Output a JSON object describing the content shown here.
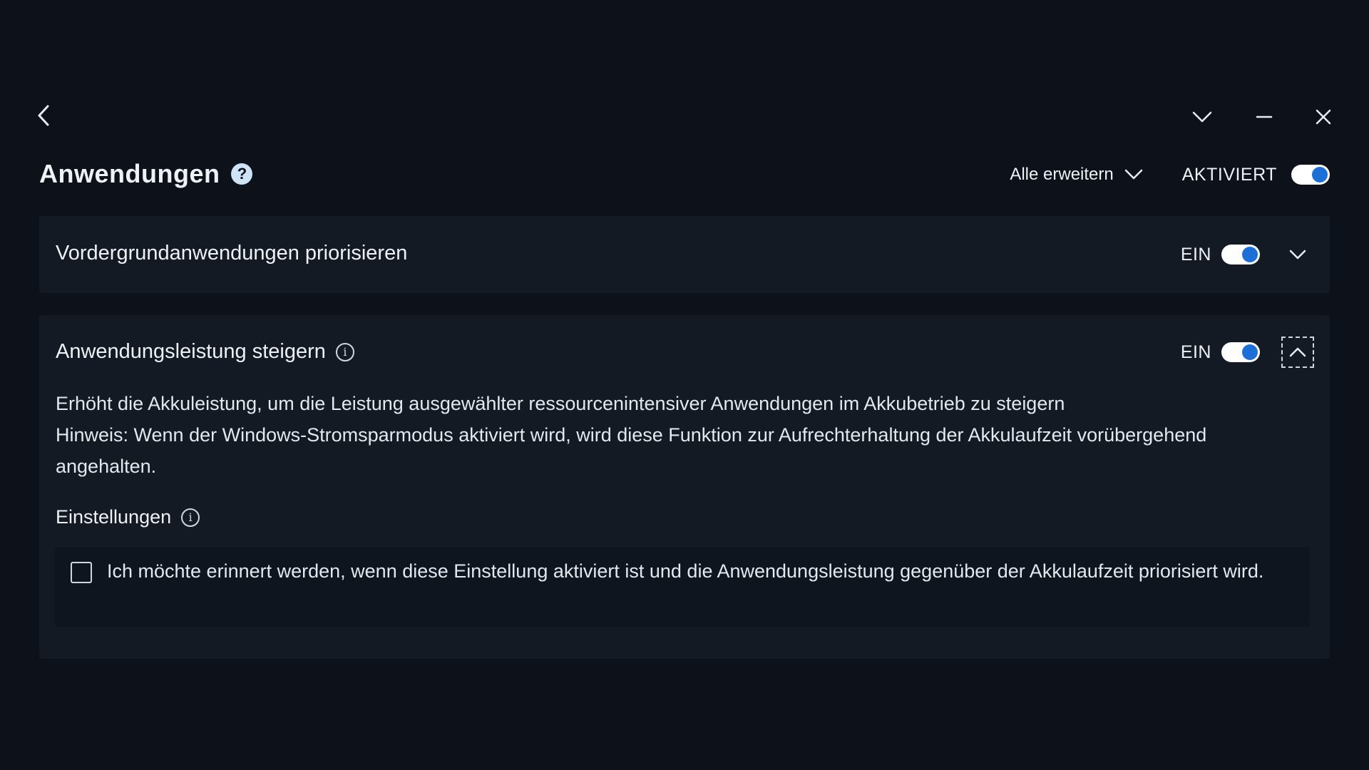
{
  "header": {
    "title": "Anwendungen",
    "help_symbol": "?",
    "expand_all_label": "Alle erweitern",
    "status_label": "AKTIVIERT",
    "status_on": true
  },
  "window_controls": {
    "back_icon": "chevron-left-icon",
    "collapse_icon": "chevron-down-icon",
    "minimize_icon": "minimize-icon",
    "close_icon": "close-icon"
  },
  "sections": [
    {
      "title": "Vordergrundanwendungen priorisieren",
      "state_label": "EIN",
      "enabled": true,
      "expanded": false
    },
    {
      "title": "Anwendungsleistung steigern",
      "info_symbol": "i",
      "state_label": "EIN",
      "enabled": true,
      "expanded": true,
      "description_line1": "Erhöht die Akkuleistung, um die Leistung ausgewählter ressourcenintensiver Anwendungen im Akkubetrieb zu steigern",
      "description_line2": "Hinweis: Wenn der Windows-Stromsparmodus aktiviert wird, wird diese Funktion zur Aufrechterhaltung der Akkulaufzeit vorübergehend angehalten.",
      "settings_heading": "Einstellungen",
      "settings_info_symbol": "i",
      "reminder_checkbox_label": "Ich möchte erinnert werden, wenn diese Einstellung aktiviert ist und die Anwendungsleistung gegenüber der Akkulaufzeit priorisiert wird.",
      "reminder_checked": false
    }
  ],
  "colors": {
    "background": "#0c111a",
    "panel": "#131a23",
    "toggle_track": "#ffffff",
    "toggle_knob": "#1d6fd8",
    "help_badge": "#cfe3f6"
  }
}
